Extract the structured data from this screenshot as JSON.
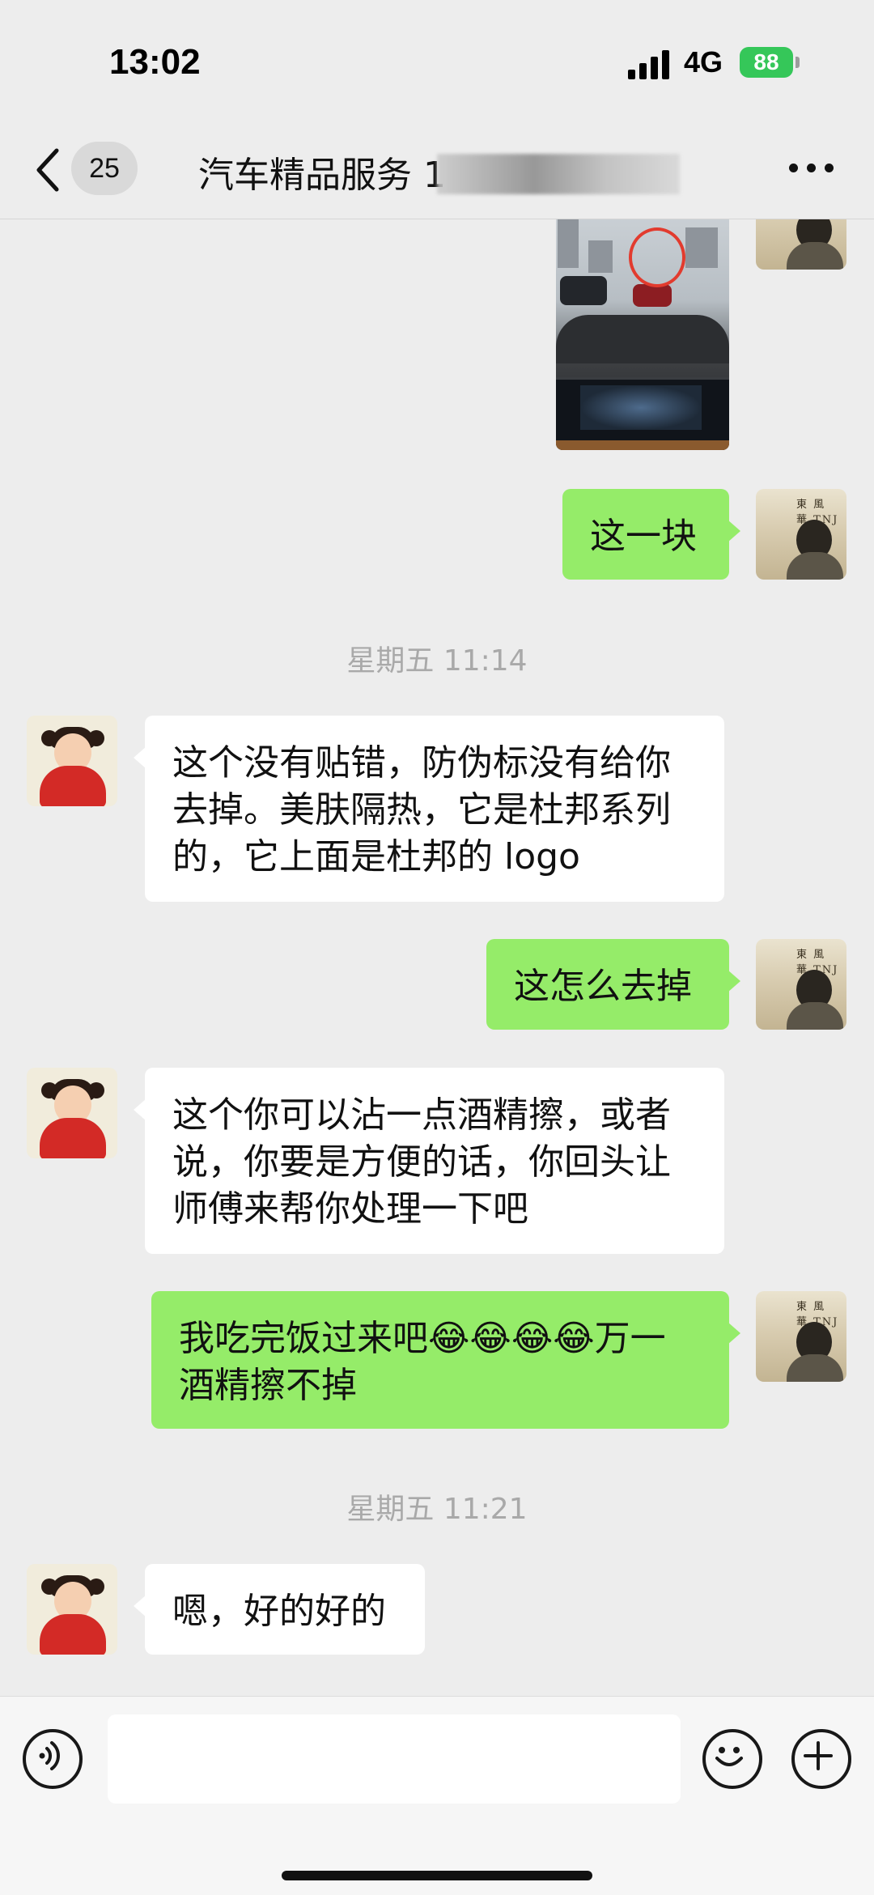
{
  "status_bar": {
    "time": "13:02",
    "network": "4G",
    "battery_level": "88",
    "battery_color": "#35c759"
  },
  "nav": {
    "back_icon": "chevron-left-icon",
    "unread_count": "25",
    "title": "汽车精品服务 1",
    "more_icon": "more-dots-icon"
  },
  "messages": [
    {
      "id": "m0",
      "direction": "in",
      "type": "image",
      "description_icon": "photo"
    },
    {
      "id": "m1",
      "direction": "out",
      "text": "这一块"
    },
    {
      "id": "ts1",
      "type": "timestamp",
      "text": "星期五 11:14"
    },
    {
      "id": "m2",
      "direction": "in",
      "lines": [
        "这个没有贴错，防伪标没有给你",
        "去掉。美肤隔热，它是杜邦系列",
        "的，它上面是杜邦的 logo"
      ]
    },
    {
      "id": "m3",
      "direction": "out",
      "text": "这怎么去掉"
    },
    {
      "id": "m4",
      "direction": "in",
      "lines": [
        "这个你可以沾一点酒精擦，或者",
        "说，你要是方便的话，你回头让",
        "师傅来帮你处理一下吧"
      ]
    },
    {
      "id": "m5",
      "direction": "out",
      "lines": [
        "我吃完饭过来吧😂😂😂😂万一",
        "酒精擦不掉"
      ]
    },
    {
      "id": "ts2",
      "type": "timestamp",
      "text": "星期五 11:21"
    },
    {
      "id": "m6",
      "direction": "in",
      "text": "嗯，好的好的"
    }
  ],
  "input_bar": {
    "voice_icon": "voice-icon",
    "emoji_icon": "emoji-icon",
    "plus_icon": "plus-icon",
    "input_value": ""
  },
  "colors": {
    "background": "#ededed",
    "outgoing_bubble": "#95ec69",
    "incoming_bubble": "#ffffff",
    "timestamp_text": "#a9a9a9"
  }
}
